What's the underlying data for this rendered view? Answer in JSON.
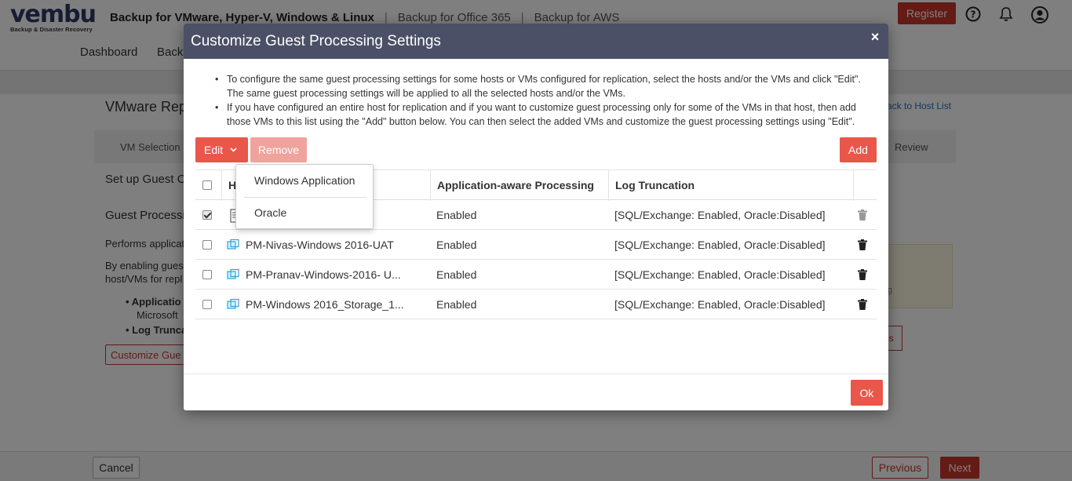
{
  "app": {
    "logo_text": "vembu",
    "logo_subtitle": "Backup & Disaster Recovery",
    "product_tabs": [
      "Backup for VMware, Hyper-V, Windows & Linux",
      "Backup for Office 365",
      "Backup for AWS"
    ],
    "register_label": "Register",
    "nav": [
      "Dashboard",
      "Back"
    ],
    "page_title": "VMware Rep",
    "back_link": "ack to Host List",
    "steps": [
      "VM Selection",
      "Review"
    ],
    "section_setup": "Set up Guest O",
    "section_guest": "Guest Processi",
    "text_performs": "Performs applicat",
    "text_enabling_1": "By enabling guest",
    "text_enabling_2": "host/VMs for repl",
    "bullet_app": "Applicatio",
    "bullet_ms": "Microsoft",
    "bullet_log": "Log Trunca",
    "customize_btn": "Customize Gue",
    "yellow_text": "g",
    "right_btn_text": "ls",
    "footer": {
      "cancel": "Cancel",
      "previous": "Previous",
      "next": "Next"
    }
  },
  "modal": {
    "title": "Customize Guest Processing Settings",
    "close_symbol": "×",
    "notes": [
      "To configure the same guest processing settings for some hosts or VMs configured for replication, select the hosts and/or the VMs and click \"Edit\". The same guest processing settings will be applied to all the selected hosts and/or the VMs.",
      "If you have configured an entire host for replication and if you want to customize guest processing only for some of the VMs in that host, then add those VMs to this list using the \"Add\" button below. You can then select the added VMs and customize the guest processing settings using \"Edit\"."
    ],
    "edit_label": "Edit",
    "remove_label": "Remove",
    "add_label": "Add",
    "ok_label": "Ok",
    "columns": {
      "host": "H",
      "app_aware": "Application-aware Processing",
      "log_truncation": "Log Truncation"
    },
    "dropdown": [
      "Windows Application",
      "Oracle"
    ],
    "rows": [
      {
        "name": "",
        "icon": "host-icon",
        "checked": true,
        "app_aware": "Enabled",
        "log": "[SQL/Exchange: Enabled, Oracle:Disabled]"
      },
      {
        "name": "PM-Nivas-Windows 2016-UAT",
        "icon": "vm-icon",
        "checked": false,
        "app_aware": "Enabled",
        "log": "[SQL/Exchange: Enabled, Oracle:Disabled]"
      },
      {
        "name": "PM-Pranav-Windows-2016- U...",
        "icon": "vm-icon",
        "checked": false,
        "app_aware": "Enabled",
        "log": "[SQL/Exchange: Enabled, Oracle:Disabled]"
      },
      {
        "name": "PM-Windows 2016_Storage_1...",
        "icon": "vm-icon",
        "checked": false,
        "app_aware": "Enabled",
        "log": "[SQL/Exchange: Enabled, Oracle:Disabled]"
      }
    ]
  },
  "colors": {
    "accent": "#e8574a",
    "brand_red": "#c9372c",
    "header_bg": "#4b5066"
  }
}
